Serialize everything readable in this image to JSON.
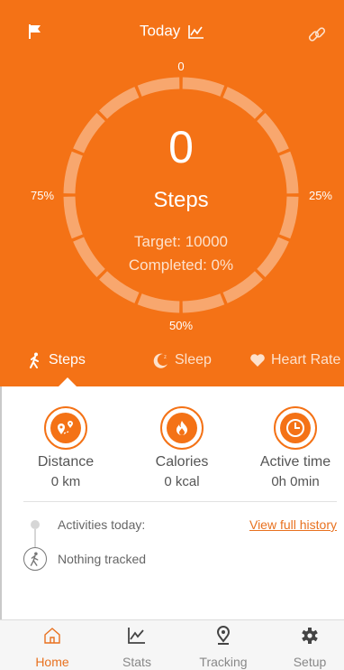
{
  "header": {
    "title": "Today",
    "flag_icon": "flag-icon",
    "chart_icon": "line-chart-icon",
    "link_icon": "link-icon",
    "accent_color": "#f47216"
  },
  "ring": {
    "label_top": "0",
    "label_right": "25%",
    "label_bottom": "50%",
    "label_left": "75%",
    "value": "0",
    "unit": "Steps",
    "target": "Target: 10000",
    "completed": "Completed: 0%",
    "progress_fraction": 0
  },
  "tabs": [
    {
      "label": "Steps",
      "icon": "walking-icon",
      "active": true
    },
    {
      "label": "Sleep",
      "icon": "moon-icon",
      "active": false
    },
    {
      "label": "Heart Rate",
      "icon": "heart-icon",
      "active": false
    }
  ],
  "stats": [
    {
      "label": "Distance",
      "value": "0 km",
      "icon": "route-pin-icon"
    },
    {
      "label": "Calories",
      "value": "0 kcal",
      "icon": "flame-icon"
    },
    {
      "label": "Active time",
      "value": "0h 0min",
      "icon": "clock-icon"
    }
  ],
  "activities": {
    "label": "Activities today:",
    "history_link": "View full history",
    "empty_text": "Nothing tracked"
  },
  "nav": [
    {
      "label": "Home",
      "icon": "home-icon",
      "active": true
    },
    {
      "label": "Stats",
      "icon": "chart-icon",
      "active": false
    },
    {
      "label": "Tracking",
      "icon": "location-pin-icon",
      "active": false
    },
    {
      "label": "Setup",
      "icon": "gear-icon",
      "active": false
    }
  ]
}
